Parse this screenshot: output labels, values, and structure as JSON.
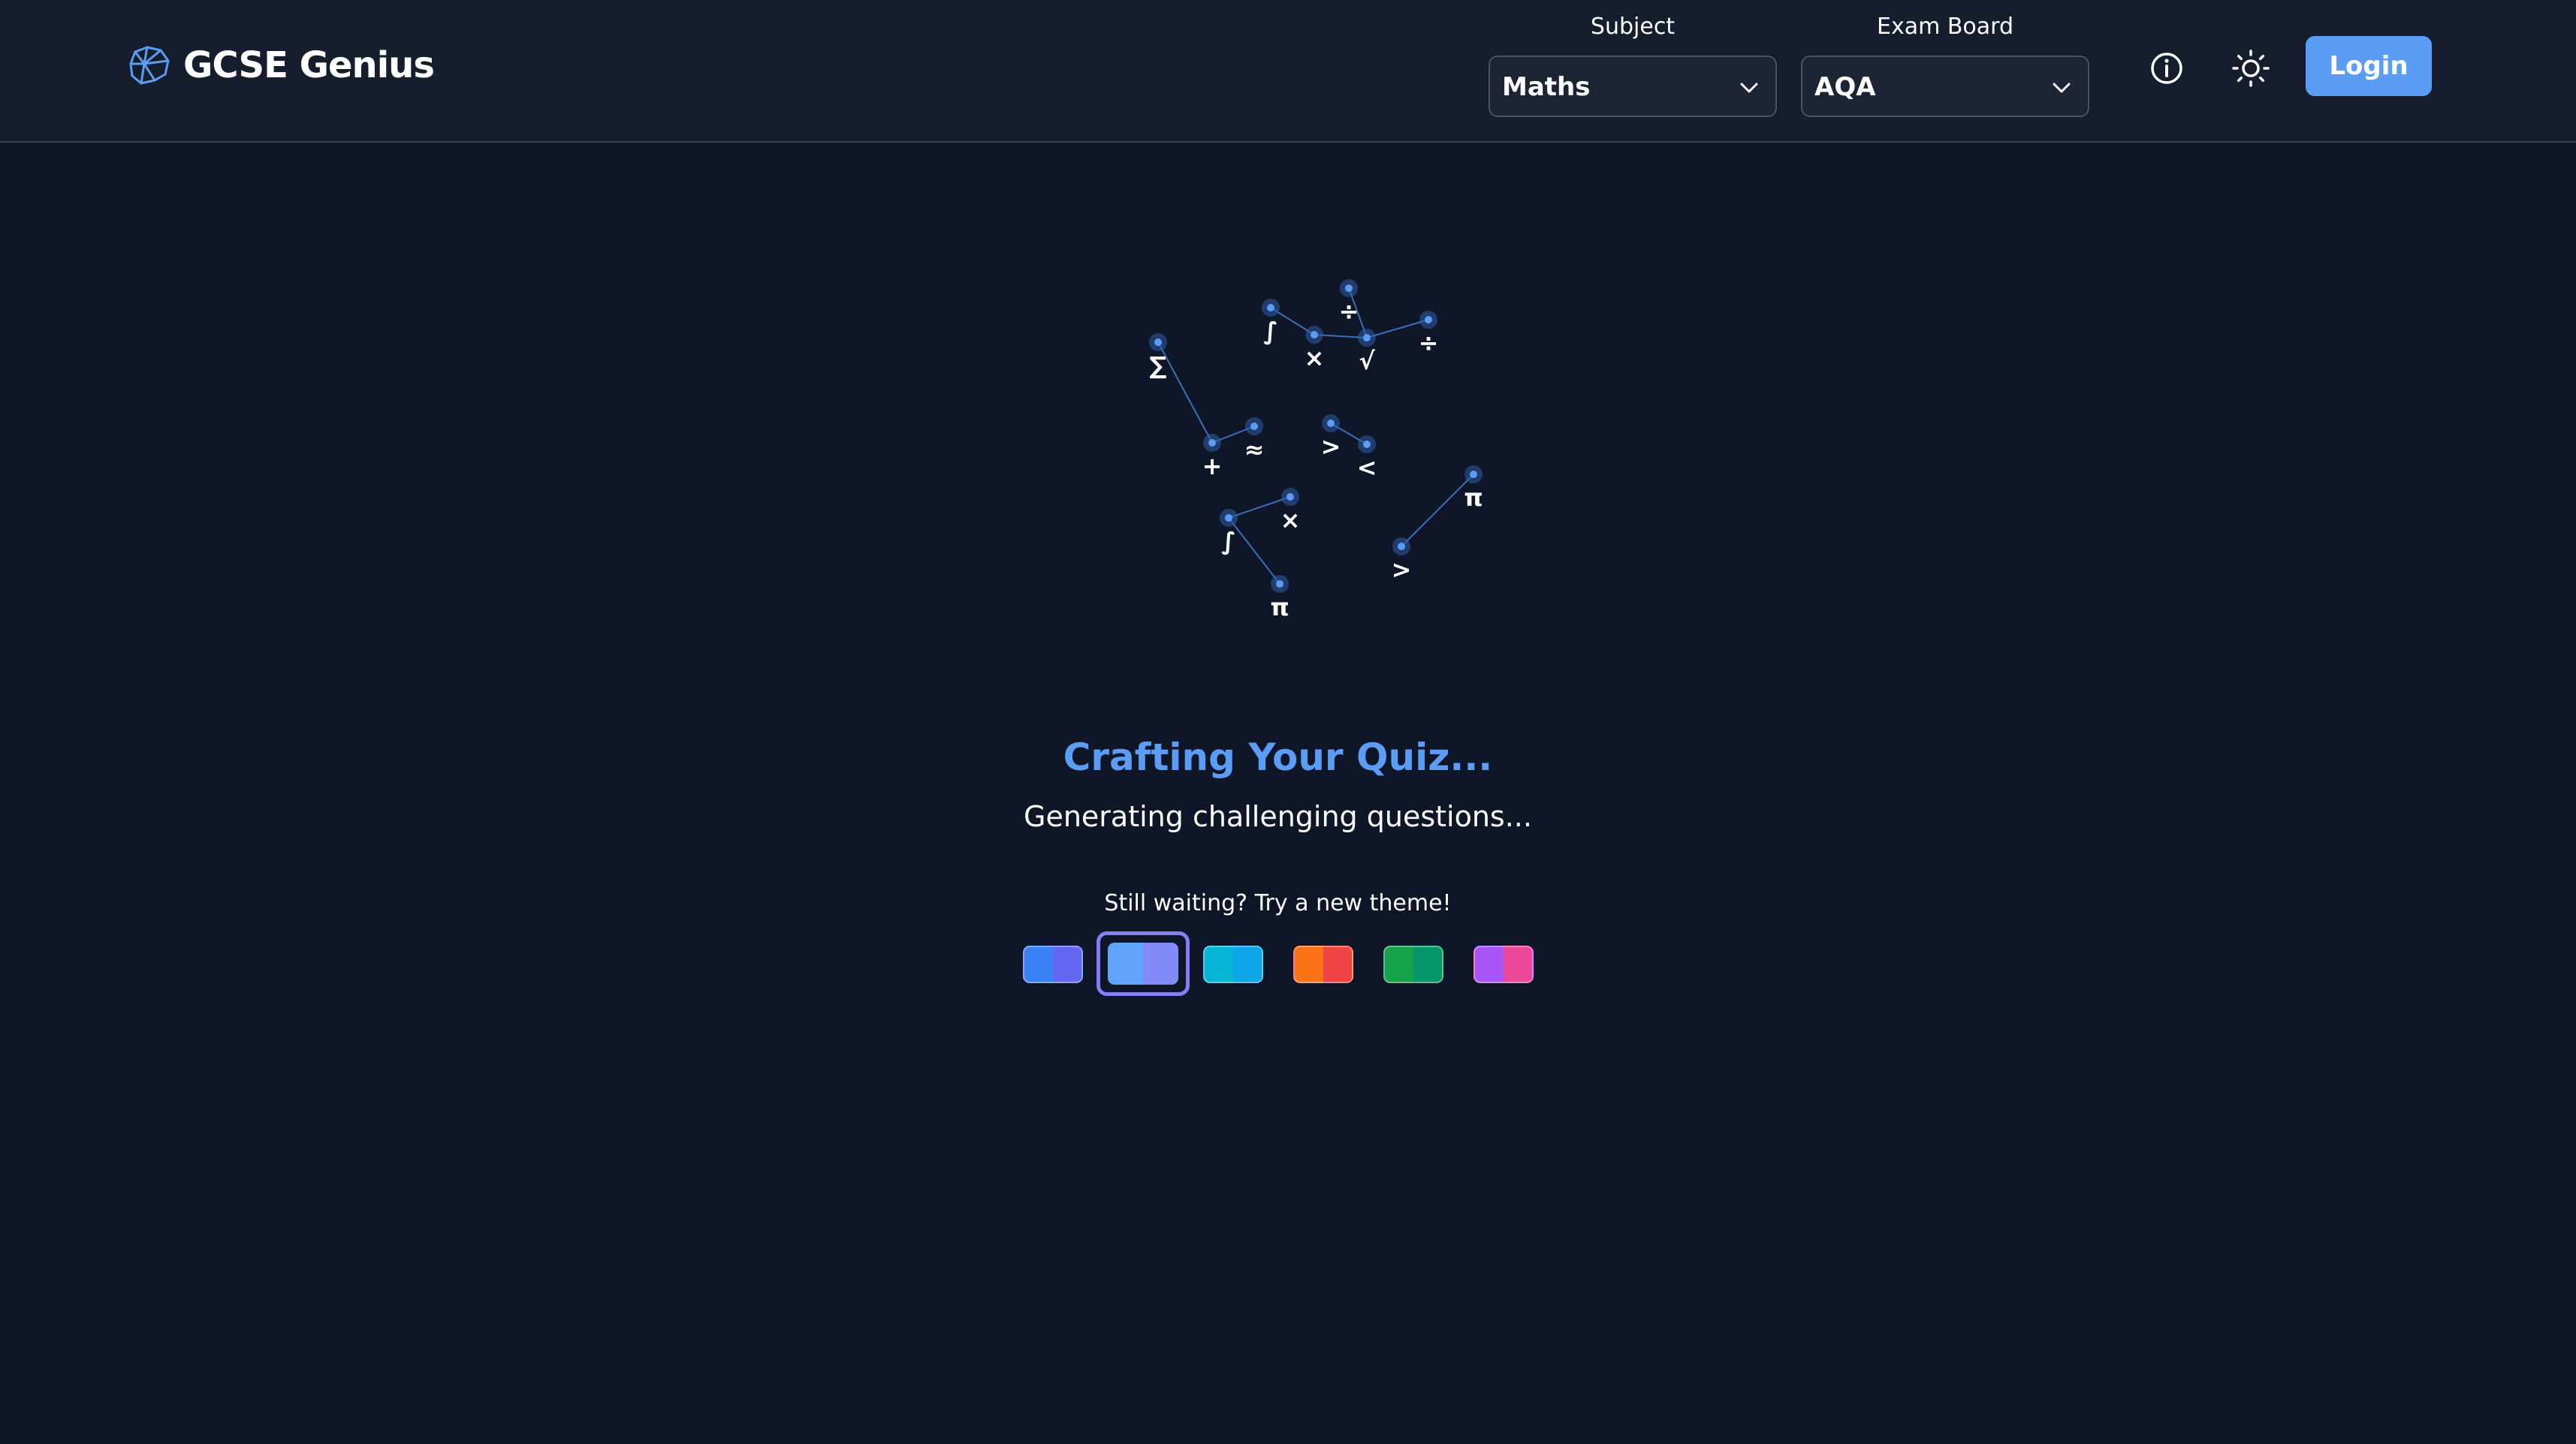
{
  "header": {
    "brand": {
      "name": "GCSE Genius",
      "icon": "brain-circuit-icon"
    },
    "subject": {
      "label": "Subject",
      "value": "Maths",
      "icon": "chevron-down-icon"
    },
    "exam_board": {
      "label": "Exam Board",
      "value": "AQA",
      "icon": "chevron-down-icon"
    },
    "info_icon": "info-icon",
    "theme_icon": "sun-icon",
    "login_label": "Login"
  },
  "loading": {
    "symbols": [
      "∑",
      "+",
      "≈",
      "∫",
      "×",
      "÷",
      "√",
      "÷",
      ">",
      "<",
      "∫",
      "×",
      "π",
      ">",
      "π"
    ],
    "title": "Crafting Your Quiz...",
    "subtitle": "Generating challenging questions..."
  },
  "themes": {
    "label": "Still waiting? Try a new theme!",
    "swatches": [
      {
        "name": "blue-indigo",
        "from": "#3b82f6",
        "to": "#6366f1"
      },
      {
        "name": "sky-violet",
        "from": "#60a5fa",
        "to": "#818cf8",
        "selected": true
      },
      {
        "name": "cyan-sky",
        "from": "#06b6d4",
        "to": "#0ea5e9"
      },
      {
        "name": "orange-red",
        "from": "#f97316",
        "to": "#ef4444"
      },
      {
        "name": "green-emerald",
        "from": "#16a34a",
        "to": "#059669"
      },
      {
        "name": "purple-pink",
        "from": "#a855f7",
        "to": "#ec4899"
      }
    ]
  },
  "colors": {
    "background": "#0e1628",
    "header": "#161e2d",
    "accent": "#5b9cf4",
    "node": "#2f5fa6",
    "selected_ring": "#8b7cf6"
  }
}
